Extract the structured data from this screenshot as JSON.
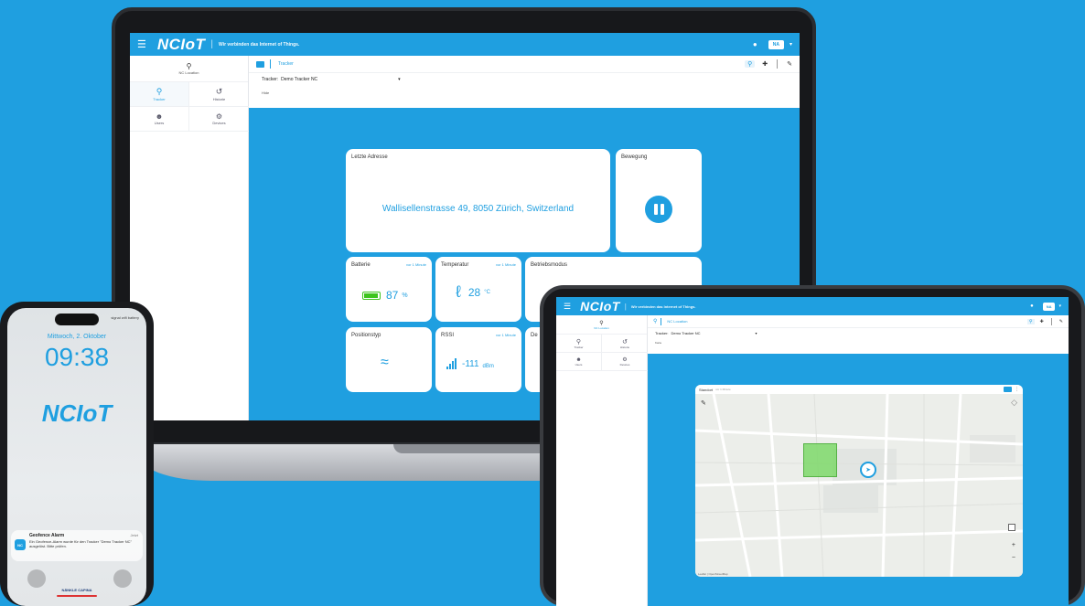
{
  "brand": {
    "name": "NCIoT",
    "tagline": "Wir verbinden das Internet of Things."
  },
  "laptop": {
    "header": {
      "bell_icon": "bell-icon",
      "user_initials": "NA"
    },
    "sidebar": {
      "location_label": "NC Location",
      "tiles": [
        {
          "label": "Tracker",
          "icon": "search-icon"
        },
        {
          "label": "Historie",
          "icon": "history-icon"
        },
        {
          "label": "Users",
          "icon": "users-icon"
        },
        {
          "label": "Devices",
          "icon": "devices-icon"
        }
      ]
    },
    "toolbar": {
      "tab_label": "Tracker",
      "tracker_label": "Tracker:",
      "tracker_value": "Demo Tracker NC",
      "breadcrumb": "Hide"
    },
    "cards": {
      "address": {
        "title": "Letzte Adresse",
        "value": "Wallisellenstrasse 49, 8050 Zürich, Switzerland"
      },
      "movement": {
        "title": "Bewegung"
      },
      "battery": {
        "title": "Batterie",
        "tag": "vor 1 Minute",
        "value": "87",
        "unit": "%"
      },
      "temperature": {
        "title": "Temperatur",
        "tag": "vor 1 Minute",
        "value": "28",
        "unit": "°C"
      },
      "mode": {
        "title": "Betriebsmodus"
      },
      "position": {
        "title": "Positionstyp"
      },
      "rssi": {
        "title": "RSSI",
        "tag": "vor 1 Minute",
        "value": "-111",
        "unit": "dBm"
      },
      "de": {
        "title": "De"
      }
    }
  },
  "phone": {
    "status_icons": "signal wifi battery",
    "date": "Mittwoch, 2. Oktober",
    "time": "09:38",
    "logo": "NCIoT",
    "notification": {
      "app_icon": "NC",
      "title": "Geofence Alarm",
      "time": "Jetzt",
      "body": "Ein Geofence-Alarm wurde für den Tracker \"Demo Tracker NC\" ausgelöst. Bitte prüfen."
    },
    "footer_text": "NÄNKLE CAPINA"
  },
  "tablet": {
    "header": {
      "user_initials": "NA"
    },
    "sidebar": {
      "location_label": "NC Location",
      "tiles": [
        {
          "label": "Tracker",
          "icon": "search-icon"
        },
        {
          "label": "Historie",
          "icon": "history-icon"
        },
        {
          "label": "Users",
          "icon": "users-icon"
        },
        {
          "label": "Devices",
          "icon": "devices-icon"
        }
      ]
    },
    "toolbar": {
      "tab_label": "NC Location",
      "tracker_label": "Tracker:",
      "tracker_value": "Demo Tracker NC",
      "breadcrumb": "Karte"
    },
    "map": {
      "title": "Standort",
      "subtitle": "vor 1 Minute",
      "attribution": "Leaflet | OpenStreetMap"
    }
  },
  "colors": {
    "accent": "#1f9fe0",
    "battery_green": "#3ec41d",
    "geofence": "#7ed96a"
  }
}
